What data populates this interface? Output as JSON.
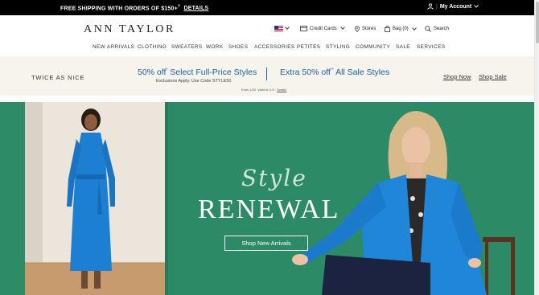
{
  "topbar": {
    "promo_text": "FREE SHIPPING WITH ORDERS OF $150+",
    "promo_sup": "†",
    "promo_link": "DETAILS",
    "account_label": "My Account"
  },
  "header": {
    "logo": "ANN TAYLOR",
    "credit_cards": "Credit Cards",
    "stores": "Stores",
    "bag": "Bag (0)",
    "search": "Search"
  },
  "nav": {
    "items": [
      "NEW ARRIVALS",
      "CLOTHING",
      "SWEATERS",
      "WORK",
      "SHOES",
      "ACCESSORIES",
      "PETITES",
      "STYLING",
      "COMMUNITY",
      "SALE",
      "SERVICES"
    ]
  },
  "promo_band": {
    "tagline": "TWICE AS NICE",
    "offer1": "50% off",
    "offer1_sup": "*",
    "offer1_rest": " Select Full-Price Styles",
    "offer1_note": "Exclusions Apply. Use Code STYLE50",
    "offer2": "Extra 50% off",
    "offer2_sup": "**",
    "offer2_rest": " All Sale Styles",
    "ends_text": "Ends 1/20. Valid in U.S.",
    "ends_link": "Details",
    "shop_now": "Shop Now",
    "shop_sale": "Shop Sale"
  },
  "hero": {
    "script_text": "Style",
    "headline": "RENEWAL",
    "cta": "Shop New Arrivals"
  },
  "colors": {
    "accent_blue": "#1b5f9a",
    "hero_green": "#2d8a66",
    "garment_blue": "#1d7fd1"
  }
}
